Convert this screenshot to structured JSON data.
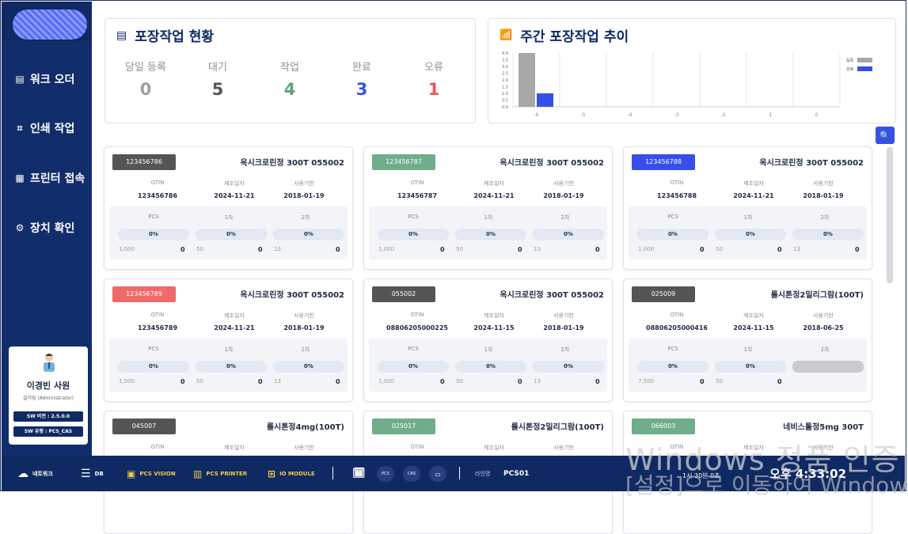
{
  "nav": [
    {
      "label": "워크 오더",
      "icon": "clipboard-icon"
    },
    {
      "label": "인쇄 작업",
      "icon": "scan-icon"
    },
    {
      "label": "프린터 접속",
      "icon": "grid-icon"
    },
    {
      "label": "장치 확인",
      "icon": "gear-icon"
    }
  ],
  "user": {
    "name": "이경빈 사원",
    "role": "설치팀 (Administrator)",
    "sw_version": "SW 버전 : 2.5.0.0",
    "sw_type": "SW 유형 : PCS_CAS"
  },
  "status_panel": {
    "title": "포장작업 현황",
    "stats": [
      {
        "label": "당일 등록",
        "value": "0",
        "color": "#9aa0a8"
      },
      {
        "label": "대기",
        "value": "5",
        "color": "#555555"
      },
      {
        "label": "작업",
        "value": "4",
        "color": "#5fa37d"
      },
      {
        "label": "완료",
        "value": "3",
        "color": "#3550e8"
      },
      {
        "label": "오류",
        "value": "1",
        "color": "#e85858"
      }
    ]
  },
  "trend_panel": {
    "title": "주간 포장작업 추이"
  },
  "chart_data": {
    "type": "bar",
    "categories": [
      "-6",
      "-5",
      "-4",
      "-3",
      "-2",
      "-1",
      "0"
    ],
    "series": [
      {
        "name": "등록",
        "values": [
          4.0,
          0,
          0,
          0,
          0,
          0,
          0
        ],
        "color": "#a8a8a8"
      },
      {
        "name": "완료",
        "values": [
          1.0,
          0,
          0,
          0,
          0,
          0,
          0
        ],
        "color": "#3550e8"
      }
    ],
    "y_ticks": [
      "4.0",
      "3.5",
      "3.0",
      "2.5",
      "2.0",
      "1.5",
      "1.0",
      "0.5",
      "0.0"
    ],
    "ylim": [
      0,
      4.0
    ],
    "legend": "top-right"
  },
  "card_labels": {
    "gtin": "GTIN",
    "mfg": "제조일자",
    "exp": "사용기한",
    "pcs": "PCS",
    "first": "1차",
    "second": "2차"
  },
  "cards": [
    {
      "code": "123456786",
      "code_color": "#555555",
      "product": "옥시크로린정 300T 055002",
      "gtin": "123456786",
      "mfg": "2024-11-21",
      "exp": "2018-01-19",
      "pcs": "0%",
      "first": "0%",
      "second": "0%",
      "t1": "1,000",
      "c1": "0",
      "t2": "50",
      "c2": "0",
      "t3": "13",
      "c3": "0"
    },
    {
      "code": "123456787",
      "code_color": "#6fae89",
      "product": "옥시크로린정 300T 055002",
      "gtin": "123456787",
      "mfg": "2024-11-21",
      "exp": "2018-01-19",
      "pcs": "0%",
      "first": "0%",
      "second": "0%",
      "t1": "1,000",
      "c1": "0",
      "t2": "50",
      "c2": "0",
      "t3": "13",
      "c3": "0"
    },
    {
      "code": "123456788",
      "code_color": "#3550e8",
      "product": "옥시크로린정 300T 055002",
      "gtin": "123456788",
      "mfg": "2024-11-21",
      "exp": "2018-01-19",
      "pcs": "0%",
      "first": "0%",
      "second": "0%",
      "t1": "1,000",
      "c1": "0",
      "t2": "50",
      "c2": "0",
      "t3": "13",
      "c3": "0"
    },
    {
      "code": "123456789",
      "code_color": "#f06a6a",
      "product": "옥시크로린정 300T 055002",
      "gtin": "123456789",
      "mfg": "2024-11-21",
      "exp": "2018-01-19",
      "pcs": "0%",
      "first": "0%",
      "second": "0%",
      "t1": "1,000",
      "c1": "0",
      "t2": "50",
      "c2": "0",
      "t3": "13",
      "c3": "0"
    },
    {
      "code": "055002",
      "code_color": "#555555",
      "product": "옥시크로린정 300T 055002",
      "gtin": "08806205000225",
      "mfg": "2024-11-15",
      "exp": "2018-01-19",
      "pcs": "0%",
      "first": "0%",
      "second": "0%",
      "t1": "1,000",
      "c1": "0",
      "t2": "50",
      "c2": "0",
      "t3": "13",
      "c3": "0"
    },
    {
      "code": "025009",
      "code_color": "#555555",
      "product": "롤시톤정2밀리그람(100T)",
      "gtin": "08806205000416",
      "mfg": "2024-11-15",
      "exp": "2018-06-25",
      "pcs": "0%",
      "first": "0%",
      "second": "",
      "t1": "7,500",
      "c1": "0",
      "t2": "50",
      "c2": "0",
      "t3": "",
      "c3": ""
    },
    {
      "code": "045007",
      "code_color": "#555555",
      "product": "롤시톤정4mg(100T)",
      "gtin": "",
      "mfg": "",
      "exp": ""
    },
    {
      "code": "025017",
      "code_color": "#6fae89",
      "product": "롤시톤정2밀리그람(100T)",
      "gtin": "",
      "mfg": "",
      "exp": ""
    },
    {
      "code": "066003",
      "code_color": "#6fae89",
      "product": "네비스톨정5mg 300T",
      "gtin": "",
      "mfg": "",
      "exp": ""
    }
  ],
  "bottombar": {
    "network": "네트워크",
    "db": "DB",
    "pcs_vision": "PCS VISION",
    "pcs_printer": "PCS PRINTER",
    "io_module": "IO MODULE",
    "btn_pcs": "PCS",
    "btn_cas": "CAS",
    "line_label": "라인명",
    "line_value": "PCS01",
    "clock": "오후 4:33:02",
    "elapsed": "1시 30분 0초"
  },
  "watermark": {
    "line1": "Windows 정품 인증",
    "line2": "[설정]으로 이동하여 Windows"
  }
}
